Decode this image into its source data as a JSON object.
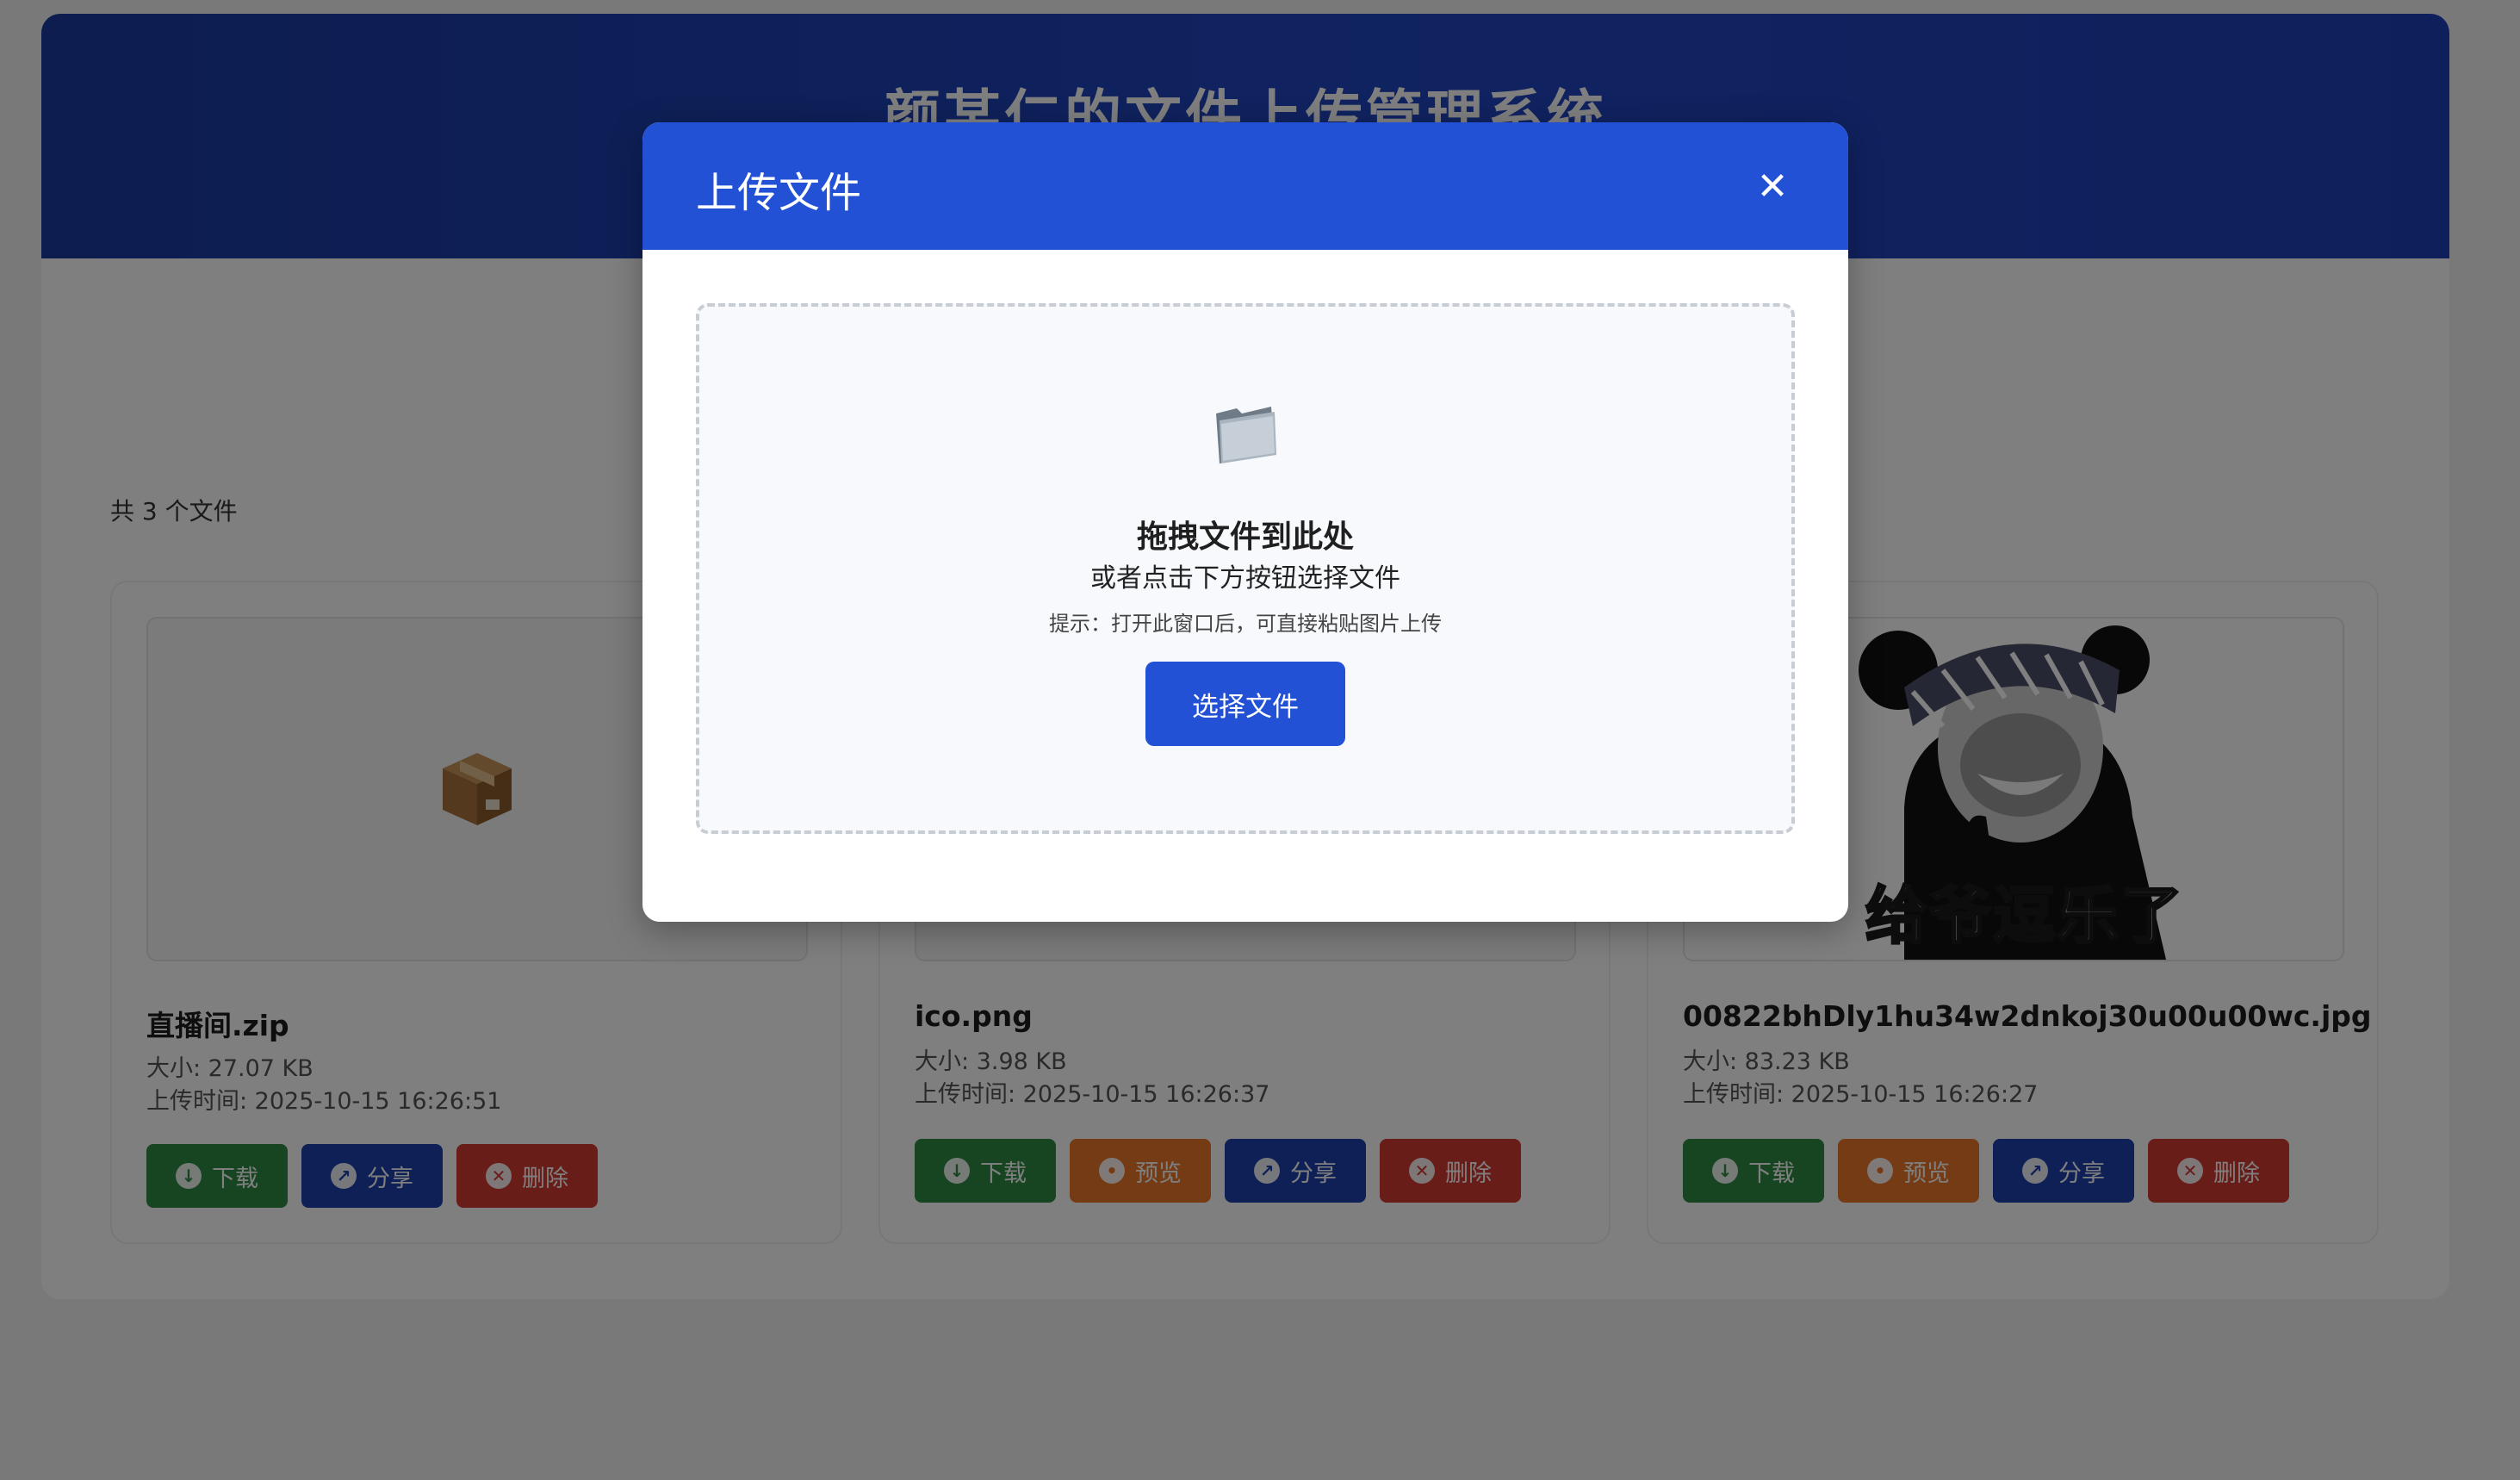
{
  "app": {
    "title": "颜某仁的文件上传管理系统"
  },
  "file_list": {
    "count_text": "共 3 个文件",
    "files": [
      {
        "name": "直播间.zip",
        "size": "大小: 27.07 KB",
        "uploaded": "上传时间: 2025-10-15 16:26:51",
        "thumb_icon": "package-icon"
      },
      {
        "name": "ico.png",
        "size": "大小: 3.98 KB",
        "uploaded": "上传时间: 2025-10-15 16:26:37"
      },
      {
        "name": "00822bhDly1hu34w2dnkoj30u00u00wc.jpg",
        "size": "大小: 83.23 KB",
        "uploaded": "上传时间: 2025-10-15 16:26:27",
        "thumb_caption": "给爷逗乐了"
      }
    ],
    "actions": {
      "download": "下载",
      "preview": "预览",
      "share": "分享",
      "delete": "删除"
    }
  },
  "modal": {
    "title": "上传文件",
    "close_icon": "close-icon",
    "dropzone": {
      "icon": "folder-icon",
      "title": "拖拽文件到此处",
      "subtitle": "或者点击下方按钮选择文件",
      "hint": "提示：打开此窗口后，可直接粘贴图片上传",
      "button": "选择文件"
    }
  },
  "colors": {
    "header_bg": "#1e40af",
    "modal_header_bg": "#2251d6",
    "download": "#2f8a45",
    "preview": "#e8772a",
    "share": "#1e40af",
    "delete": "#d33a32"
  }
}
